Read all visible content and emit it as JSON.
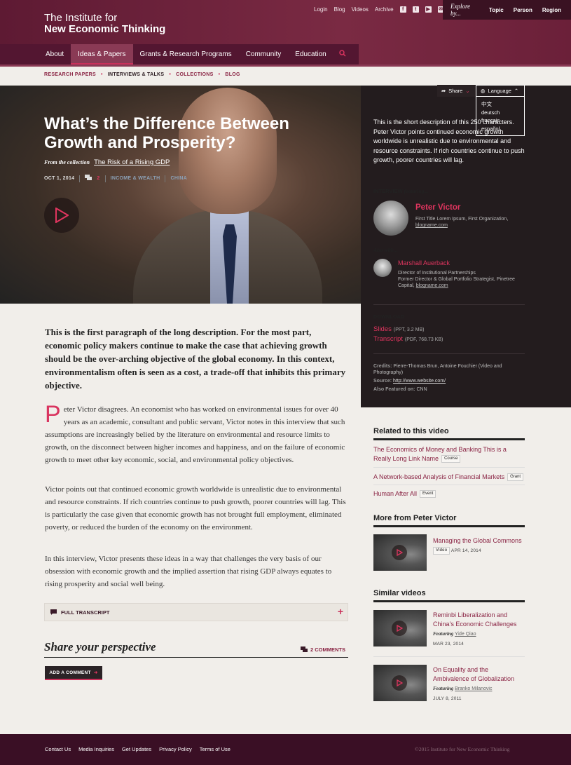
{
  "header": {
    "logo_line1": "The Institute for",
    "logo_line2": "New Economic Thinking",
    "util_links": [
      "Login",
      "Blog",
      "Videos",
      "Archive"
    ],
    "social_icons": [
      "facebook-icon",
      "twitter-icon",
      "youtube-icon",
      "mail-icon"
    ],
    "explore_label": "Explore by...",
    "explore_items": [
      "Topic",
      "Person",
      "Region"
    ],
    "nav": [
      "About",
      "Ideas & Papers",
      "Grants & Research Programs",
      "Community",
      "Education"
    ],
    "nav_active": "Ideas & Papers"
  },
  "subnav": {
    "items": [
      "RESEARCH PAPERS",
      "INTERVIEWS & TALKS",
      "COLLECTIONS",
      "BLOG"
    ],
    "current": "INTERVIEWS & TALKS"
  },
  "hero": {
    "title": "What’s the Difference Between Growth and Prosperity?",
    "from_label": "From the collection",
    "collection": "The Risk of a Rising GDP",
    "date": "OCT 1, 2014",
    "comment_count": "2",
    "tags": [
      "INCOME & WEALTH",
      "CHINA"
    ]
  },
  "sidebar": {
    "share_label": "Share",
    "language_label": "Language",
    "languages": [
      "中文",
      "deutsch",
      "français",
      "español"
    ],
    "short_description": "This is the short description of this 250 characters. Peter Victor points continued economic growth worldwide is unrealistic due to environmental and resource constraints. If rich countries continue to push growth, poorer countries will lag.",
    "interview_label": "INTERVIEW",
    "featuring_label": "featuring...",
    "featured_name": "Peter Victor",
    "featured_title": "First Title Lorem Ipsum, First Organization,",
    "featured_link": "blogname.com",
    "also_label": "Also with...",
    "also_name": "Marshall Auerback",
    "also_title1": "Director of Institutional Partnerships",
    "also_title2": "Former Director & Global Portfolio Strategist, Pinetree Capital,",
    "also_link": "blogname.com",
    "download_label": "DOWNLOAD",
    "downloads": [
      {
        "name": "Slides",
        "meta": "(PPT, 3.2 MB)"
      },
      {
        "name": "Transcript",
        "meta": "(PDF, 768.73 KB)"
      }
    ],
    "credits_label": "Credits:",
    "credits": "Pierre-Thomas Brun, Antoine Fouchier (Video and Photography)",
    "source_label": "Source:",
    "source": "http://www.website.com/",
    "featured_on_label": "Also Featured on:",
    "featured_on": "CNN"
  },
  "article": {
    "lead": "This is the first paragraph of the long description. For the most part, economic policy makers continue to make the case that achieving growth should be the over-arching objective of the global economy. In this context, environmentalism often is seen as a cost, a trade-off that inhibits this primary objective.",
    "dropcap": "P",
    "p1": "eter Victor disagrees. An economist who has worked on environmental issues for over 40 years as an academic, consultant and public servant, Victor notes in this interview that such assumptions are increasingly belied by the literature on environmental and resource limits to growth, on the disconnect between higher incomes and happiness, and on the failure of economic growth to meet other key economic, social, and environmental policy objectives.",
    "p2": "Victor points out that continued economic growth worldwide is unrealistic due to environmental and resource constraints. If rich countries continue to push growth, poorer countries will lag. This is particularly the case given that economic growth has not brought full employment, eliminated poverty, or reduced the burden of the economy on the environment.",
    "p3": "In this interview, Victor presents these ideas in a way that challenges the very basis of our obsession with economic growth and the implied assertion that rising GDP always equates to rising prosperity and social well being.",
    "transcript_label": "FULL TRANSCRIPT",
    "share_heading": "Share your perspective",
    "comments_label": "2 COMMENTS",
    "add_comment": "ADD A COMMENT"
  },
  "related": {
    "heading": "Related to this video",
    "items": [
      {
        "title": "The Economics of Money and Banking This is a Really Long Link Name",
        "badge": "Course"
      },
      {
        "title": "A Network-based Analysis of Financial Markets",
        "badge": "Grant"
      },
      {
        "title": "Human After All",
        "badge": "Event"
      }
    ]
  },
  "more_from": {
    "heading": "More from Peter Victor",
    "title": "Managing the Global Commons",
    "badge": "Video",
    "date": "APR 14, 2014"
  },
  "similar": {
    "heading": "Similar videos",
    "featuring_label": "Featuring",
    "items": [
      {
        "title": "Reminbi Liberalization and China’s Economic Challenges",
        "person": "Yide Qiao",
        "date": "MAR 23, 2014"
      },
      {
        "title": "On Equality and the Ambivalence of Globalization",
        "person": "Branko Milanovic",
        "date": "JULY 8, 2011"
      }
    ]
  },
  "footer": {
    "links": [
      "Contact Us",
      "Media Inquiries",
      "Get Updates",
      "Privacy Policy",
      "Terms of Use"
    ],
    "copyright": "©2015 Institute for New Economic Thinking"
  },
  "colors": {
    "brand": "#6b2039",
    "accent": "#e0355f",
    "dark": "#231c1e"
  }
}
